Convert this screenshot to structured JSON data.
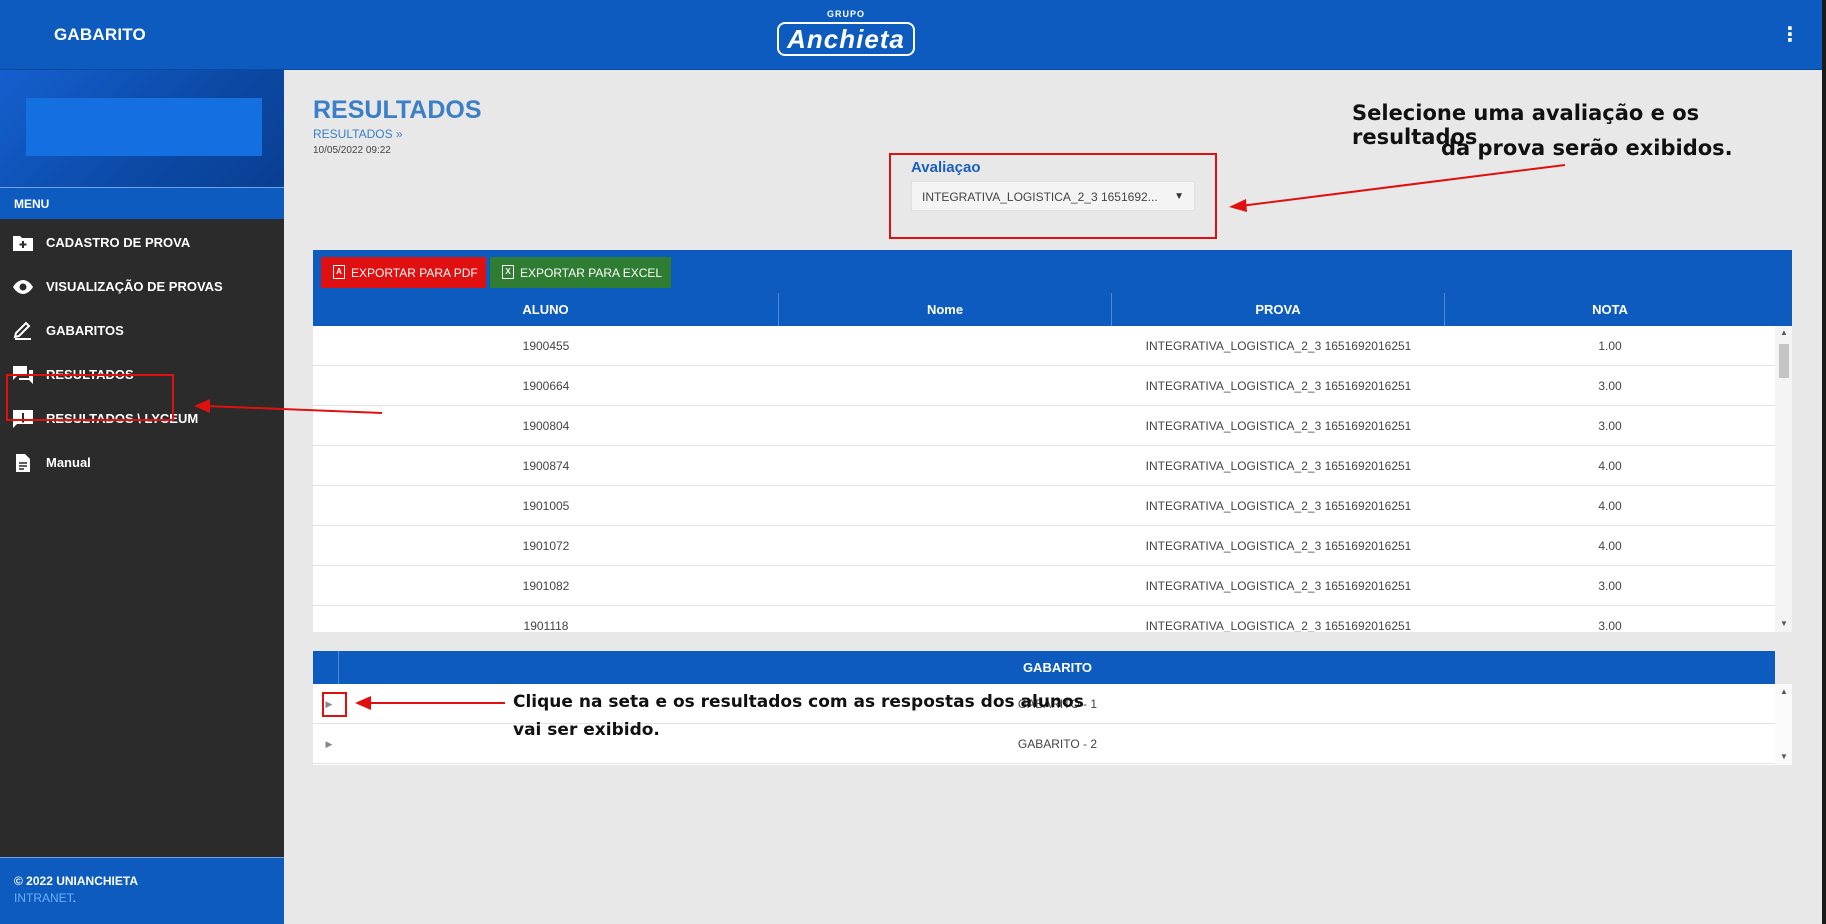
{
  "app": {
    "title": "GABARITO",
    "logo_top": "GRUPO",
    "logo_main": "Anchieta",
    "menu_icon": "more-vert-icon"
  },
  "sidebar": {
    "menu_label": "MENU",
    "items": [
      {
        "label": "CADASTRO DE PROVA",
        "icon": "folder-add-icon"
      },
      {
        "label": "VISUALIZAÇÃO DE PROVAS",
        "icon": "eye-icon"
      },
      {
        "label": "GABARITOS",
        "icon": "edit-pen-icon"
      },
      {
        "label": "RESULTADOS",
        "icon": "chat-icon"
      },
      {
        "label": "RESULTADOS \\ LYCEUM",
        "icon": "alert-message-icon"
      },
      {
        "label": "Manual",
        "icon": "document-icon"
      }
    ],
    "footer_copyright": "© 2022 UNIANCHIETA",
    "footer_link": "INTRANET",
    "footer_link_suffix": "."
  },
  "page": {
    "title": "RESULTADOS",
    "breadcrumb": "RESULTADOS »",
    "date": "10/05/2022 09:22"
  },
  "filter": {
    "label": "Avaliaçao",
    "selected": "INTEGRATIVA_LOGISTICA_2_3 1651692..."
  },
  "toolbar": {
    "pdf_label": "EXPORTAR PARA PDF",
    "excel_label": "EXPORTAR PARA EXCEL",
    "pdf_color": "#e01010",
    "excel_color": "#2e7d32"
  },
  "results_table": {
    "columns": [
      "ALUNO",
      "Nome",
      "PROVA",
      "NOTA"
    ],
    "rows": [
      {
        "aluno": "1900455",
        "nome": "",
        "prova": "INTEGRATIVA_LOGISTICA_2_3 1651692016251",
        "nota": "1.00"
      },
      {
        "aluno": "1900664",
        "nome": "",
        "prova": "INTEGRATIVA_LOGISTICA_2_3 1651692016251",
        "nota": "3.00"
      },
      {
        "aluno": "1900804",
        "nome": "",
        "prova": "INTEGRATIVA_LOGISTICA_2_3 1651692016251",
        "nota": "3.00"
      },
      {
        "aluno": "1900874",
        "nome": "",
        "prova": "INTEGRATIVA_LOGISTICA_2_3 1651692016251",
        "nota": "4.00"
      },
      {
        "aluno": "1901005",
        "nome": "",
        "prova": "INTEGRATIVA_LOGISTICA_2_3 1651692016251",
        "nota": "4.00"
      },
      {
        "aluno": "1901072",
        "nome": "",
        "prova": "INTEGRATIVA_LOGISTICA_2_3 1651692016251",
        "nota": "4.00"
      },
      {
        "aluno": "1901082",
        "nome": "",
        "prova": "INTEGRATIVA_LOGISTICA_2_3 1651692016251",
        "nota": "3.00"
      },
      {
        "aluno": "1901118",
        "nome": "",
        "prova": "INTEGRATIVA_LOGISTICA_2_3 1651692016251",
        "nota": "3.00"
      }
    ]
  },
  "gabarito_table": {
    "header": "GABARITO",
    "rows": [
      "GABARITO - 1",
      "GABARITO - 2"
    ]
  },
  "annotations": {
    "select_note_line1": "Selecione uma avaliação e os resultados",
    "select_note_line2": "da prova serão exibidos.",
    "expand_note_line1": "Clique na seta e os resultados com as respostas dos alunos",
    "expand_note_line2": "vai ser exibido.",
    "highlight_color": "#e01010"
  },
  "colors": {
    "primary": "#0d5bbf",
    "sidebar_bg": "#2b2b2b",
    "title_blue": "#3a7fc8"
  }
}
